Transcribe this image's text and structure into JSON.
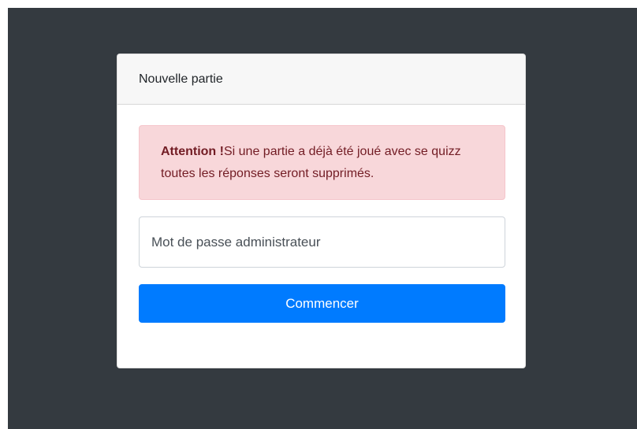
{
  "card": {
    "header_title": "Nouvelle partie"
  },
  "alert": {
    "title": "Attention !",
    "message": "Si une partie a déjà été joué avec se quizz toutes les réponses seront supprimés."
  },
  "password": {
    "value": "",
    "placeholder": "Mot de passe administrateur"
  },
  "start_button": {
    "label": "Commencer"
  },
  "colors": {
    "backdrop": "#343a40",
    "alert_bg": "#f8d7da",
    "alert_text": "#721c24",
    "primary": "#007bff"
  }
}
